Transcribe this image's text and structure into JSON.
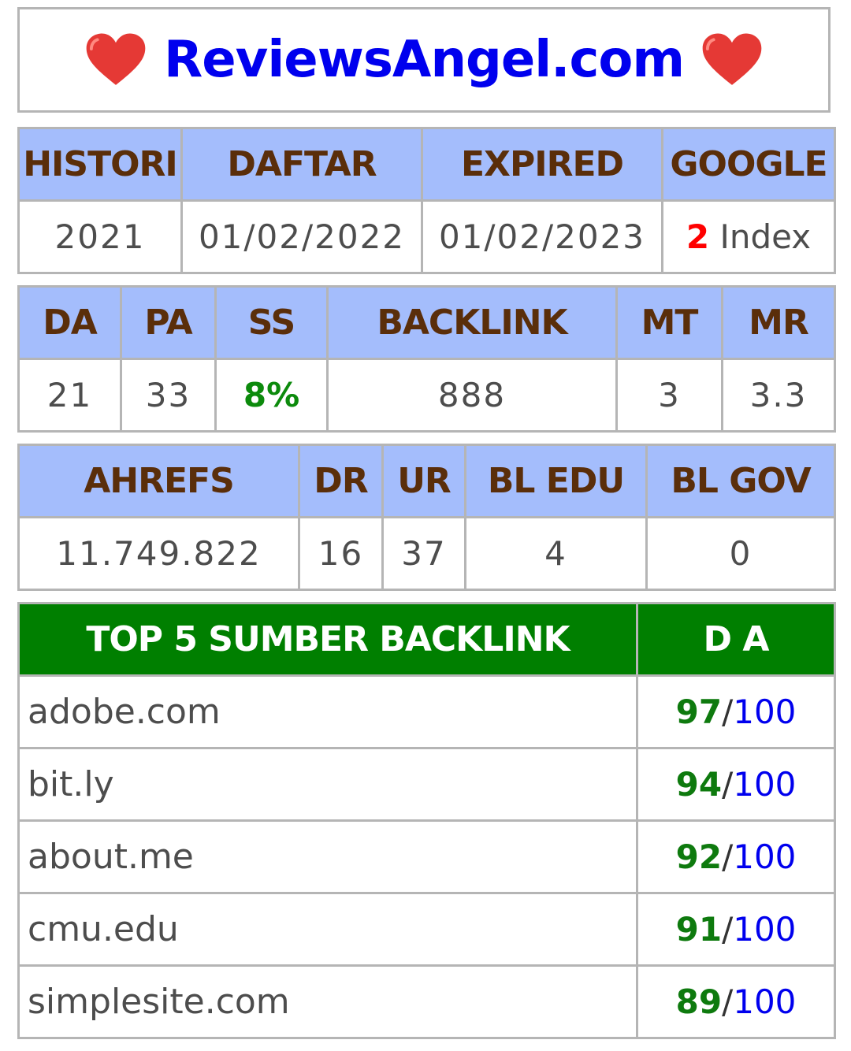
{
  "header": {
    "title": "ReviewsAngel.com",
    "heart_color": "#e53935",
    "title_color": "#0000ee"
  },
  "table1": {
    "headers": [
      "HISTORI",
      "DAFTAR",
      "EXPIRED",
      "GOOGLE"
    ],
    "values": {
      "histori": "2021",
      "daftar": "01/02/2022",
      "expired": "01/02/2023",
      "google_count": "2",
      "google_label": " Index"
    }
  },
  "table2": {
    "headers": [
      "DA",
      "PA",
      "SS",
      "BACKLINK",
      "MT",
      "MR"
    ],
    "values": [
      "21",
      "33",
      "8%",
      "888",
      "3",
      "3.3"
    ]
  },
  "table3": {
    "headers": [
      "AHREFS",
      "DR",
      "UR",
      "BL EDU",
      "BL GOV"
    ],
    "values": [
      "11.749.822",
      "16",
      "37",
      "4",
      "0"
    ]
  },
  "table4": {
    "headers": [
      "TOP 5 SUMBER BACKLINK",
      "D A"
    ],
    "rows": [
      {
        "site": "adobe.com",
        "score": "97",
        "max": "100"
      },
      {
        "site": "bit.ly",
        "score": "94",
        "max": "100"
      },
      {
        "site": "about.me",
        "score": "92",
        "max": "100"
      },
      {
        "site": "cmu.edu",
        "score": "91",
        "max": "100"
      },
      {
        "site": "simplesite.com",
        "score": "89",
        "max": "100"
      }
    ],
    "slash": "/"
  },
  "colors": {
    "header_bg": "#a4bdfc",
    "header_text": "#5a2e0a",
    "green_header_bg": "#007f00",
    "score_green": "#0e7a0e",
    "index_red": "#ff0000"
  }
}
